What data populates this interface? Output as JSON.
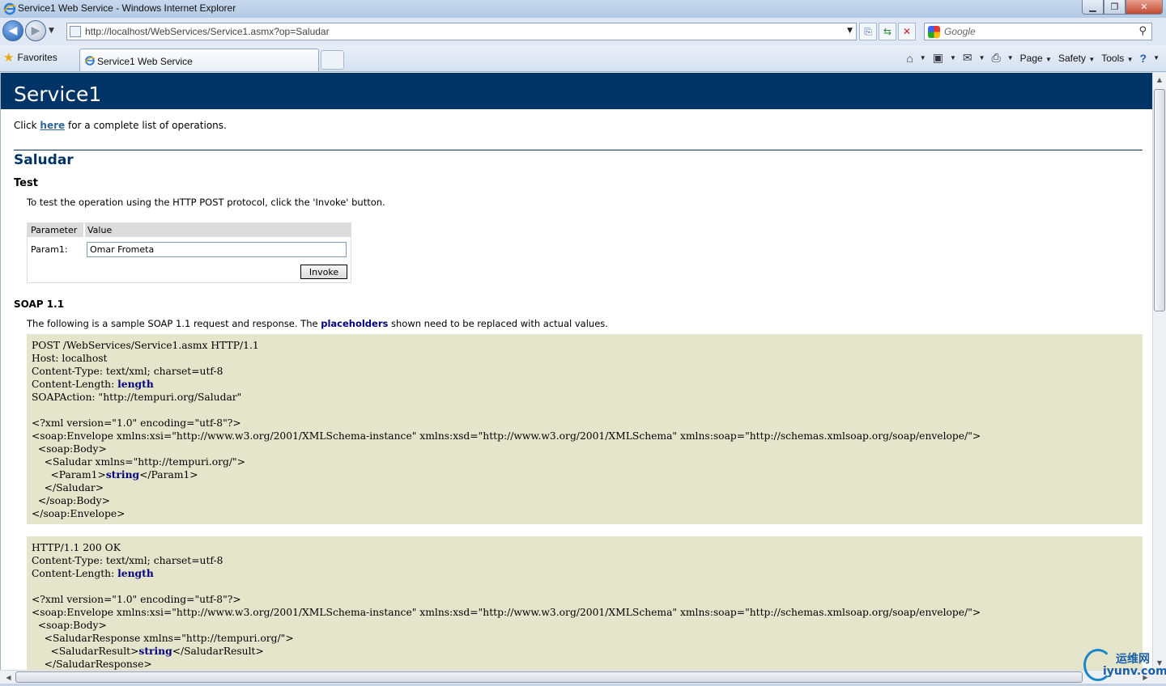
{
  "window": {
    "title": "Service1 Web Service - Windows Internet Explorer",
    "controls": {
      "minimize": "▁",
      "maximize": "❐",
      "close": "✕"
    }
  },
  "address_bar": {
    "url": "http://localhost/WebServices/Service1.asmx?op=Saludar",
    "search_placeholder": "Google"
  },
  "favorites_label": "Favorites",
  "tab": {
    "label": "Service1 Web Service"
  },
  "command_bar": {
    "page": "Page",
    "safety": "Safety",
    "tools": "Tools"
  },
  "page": {
    "heading": "Service1",
    "intro_before": "Click ",
    "intro_link": "here",
    "intro_after": " for a complete list of operations.",
    "operation": "Saludar",
    "test_heading": "Test",
    "test_description": "To test the operation using the HTTP POST protocol, click the 'Invoke' button.",
    "form": {
      "col_parameter": "Parameter",
      "col_value": "Value",
      "param_label": "Param1:",
      "param_value": "Omar Frometa",
      "invoke_label": "Invoke"
    },
    "soap_heading": "SOAP 1.1",
    "soap_desc_before": "The following is a sample SOAP 1.1 request and response. The ",
    "soap_desc_bold": "placeholders",
    "soap_desc_after": " shown need to be replaced with actual values.",
    "request": {
      "l1": "POST /WebServices/Service1.asmx HTTP/1.1",
      "l2": "Host: localhost",
      "l3": "Content-Type: text/xml; charset=utf-8",
      "l4a": "Content-Length: ",
      "l4b": "length",
      "l5": "SOAPAction: \"http://tempuri.org/Saludar\"",
      "l7": "<?xml version=\"1.0\" encoding=\"utf-8\"?>",
      "l8": "<soap:Envelope xmlns:xsi=\"http://www.w3.org/2001/XMLSchema-instance\" xmlns:xsd=\"http://www.w3.org/2001/XMLSchema\" xmlns:soap=\"http://schemas.xmlsoap.org/soap/envelope/\">",
      "l9": "  <soap:Body>",
      "l10": "    <Saludar xmlns=\"http://tempuri.org/\">",
      "l11a": "      <Param1>",
      "l11b": "string",
      "l11c": "</Param1>",
      "l12": "    </Saludar>",
      "l13": "  </soap:Body>",
      "l14": "</soap:Envelope>"
    },
    "response": {
      "l1": "HTTP/1.1 200 OK",
      "l2": "Content-Type: text/xml; charset=utf-8",
      "l3a": "Content-Length: ",
      "l3b": "length",
      "l5": "<?xml version=\"1.0\" encoding=\"utf-8\"?>",
      "l6": "<soap:Envelope xmlns:xsi=\"http://www.w3.org/2001/XMLSchema-instance\" xmlns:xsd=\"http://www.w3.org/2001/XMLSchema\" xmlns:soap=\"http://schemas.xmlsoap.org/soap/envelope/\">",
      "l7": "  <soap:Body>",
      "l8": "    <SaludarResponse xmlns=\"http://tempuri.org/\">",
      "l9a": "      <SaludarResult>",
      "l9b": "string",
      "l9c": "</SaludarResult>",
      "l10": "    </SaludarResponse>"
    }
  },
  "watermark": {
    "line1": "运维网",
    "line2": "iyunv.com"
  }
}
